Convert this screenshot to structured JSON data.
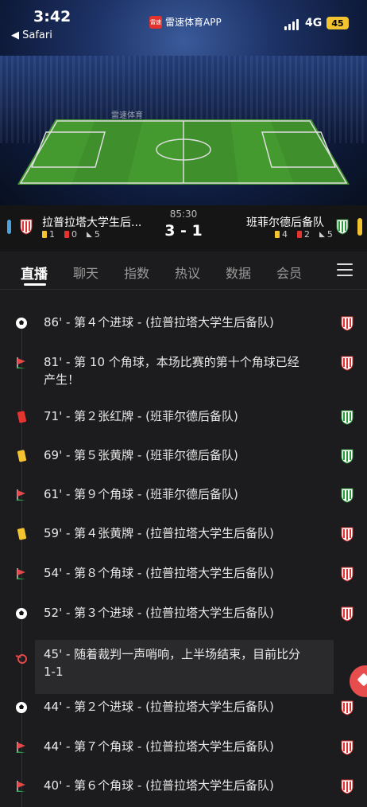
{
  "status_bar": {
    "time": "3:42",
    "back": "◀ Safari",
    "app_name": "雷速体育APP",
    "app_logo_text": "雷速",
    "network": "4G",
    "battery": "45"
  },
  "stadium": {
    "watermark": "雷速体育"
  },
  "match": {
    "minute": "85:30",
    "score": "3 - 1",
    "home": {
      "name": "拉普拉塔大学生后...",
      "yellow": "1",
      "red": "0",
      "corners": "5"
    },
    "away": {
      "name": "班菲尔德后备队",
      "yellow": "4",
      "red": "2",
      "corners": "5"
    }
  },
  "tabs": [
    "直播",
    "聊天",
    "指数",
    "热议",
    "数据",
    "会员"
  ],
  "events": [
    {
      "type": "goal",
      "team": "home",
      "text": "86' - 第４个进球 - (拉普拉塔大学生后备队)"
    },
    {
      "type": "corner",
      "team": "home",
      "text": "81' - 第 10 个角球，本场比赛的第十个角球已经产生！"
    },
    {
      "type": "red",
      "team": "away",
      "text": "71' - 第２张红牌 - (班菲尔德后备队)"
    },
    {
      "type": "yellow",
      "team": "away",
      "text": "69' - 第５张黄牌 - (班菲尔德后备队)"
    },
    {
      "type": "corner",
      "team": "away",
      "text": "61' - 第９个角球 - (班菲尔德后备队)"
    },
    {
      "type": "yellow",
      "team": "home",
      "text": "59' - 第４张黄牌 - (拉普拉塔大学生后备队)"
    },
    {
      "type": "corner",
      "team": "home",
      "text": "54' - 第８个角球 - (拉普拉塔大学生后备队)"
    },
    {
      "type": "goal",
      "team": "home",
      "text": "52' - 第３个进球 - (拉普拉塔大学生后备队)"
    },
    {
      "type": "whistle",
      "team": "",
      "text": "45' - 随着裁判一声哨响，上半场结束，目前比分 1-1"
    },
    {
      "type": "goal",
      "team": "home",
      "text": "44' - 第２个进球 - (拉普拉塔大学生后备队)"
    },
    {
      "type": "corner",
      "team": "home",
      "text": "44' - 第７个角球 - (拉普拉塔大学生后备队)"
    },
    {
      "type": "corner",
      "team": "home",
      "text": "40' - 第６个角球 - (拉普拉塔大学生后备队)"
    }
  ]
}
